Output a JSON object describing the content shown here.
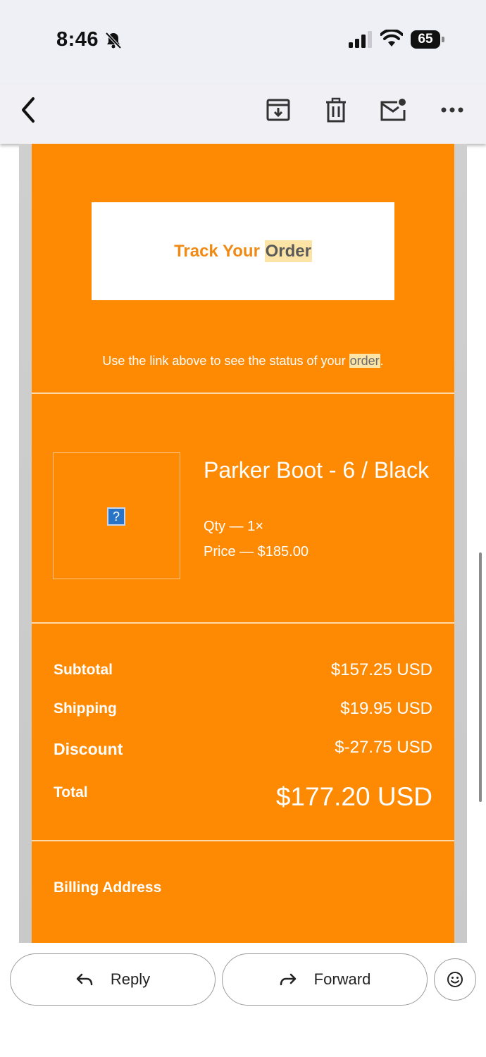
{
  "status_bar": {
    "time": "8:46",
    "battery": "65"
  },
  "email": {
    "track_button": {
      "text_before": "Track Your",
      "highlight": "Order"
    },
    "link_note": {
      "text_before": "Use the link above to see the status of your",
      "highlight": "order",
      "text_after": "."
    },
    "product": {
      "name": "Parker Boot - 6 / Black",
      "qty": "Qty — 1×",
      "price": "Price — $185.00",
      "image_placeholder": "?"
    },
    "summary": {
      "subtotal_label": "Subtotal",
      "subtotal_value": "$157.25 USD",
      "shipping_label": "Shipping",
      "shipping_value": "$19.95 USD",
      "discount_label": "Discount",
      "discount_value": "$-27.75 USD",
      "total_label": "Total",
      "total_value": "$177.20 USD"
    },
    "billing_label": "Billing Address"
  },
  "actions": {
    "reply": "Reply",
    "forward": "Forward"
  },
  "icons": [
    "back-arrow-icon",
    "archive-icon",
    "trash-icon",
    "mark-unread-icon",
    "more-icon",
    "bell-off-icon",
    "signal-icon",
    "wifi-icon",
    "battery-icon",
    "reply-icon",
    "forward-icon",
    "emoji-icon"
  ],
  "colors": {
    "accent": "#fe8a04",
    "highlight": "#fbe4a6"
  }
}
